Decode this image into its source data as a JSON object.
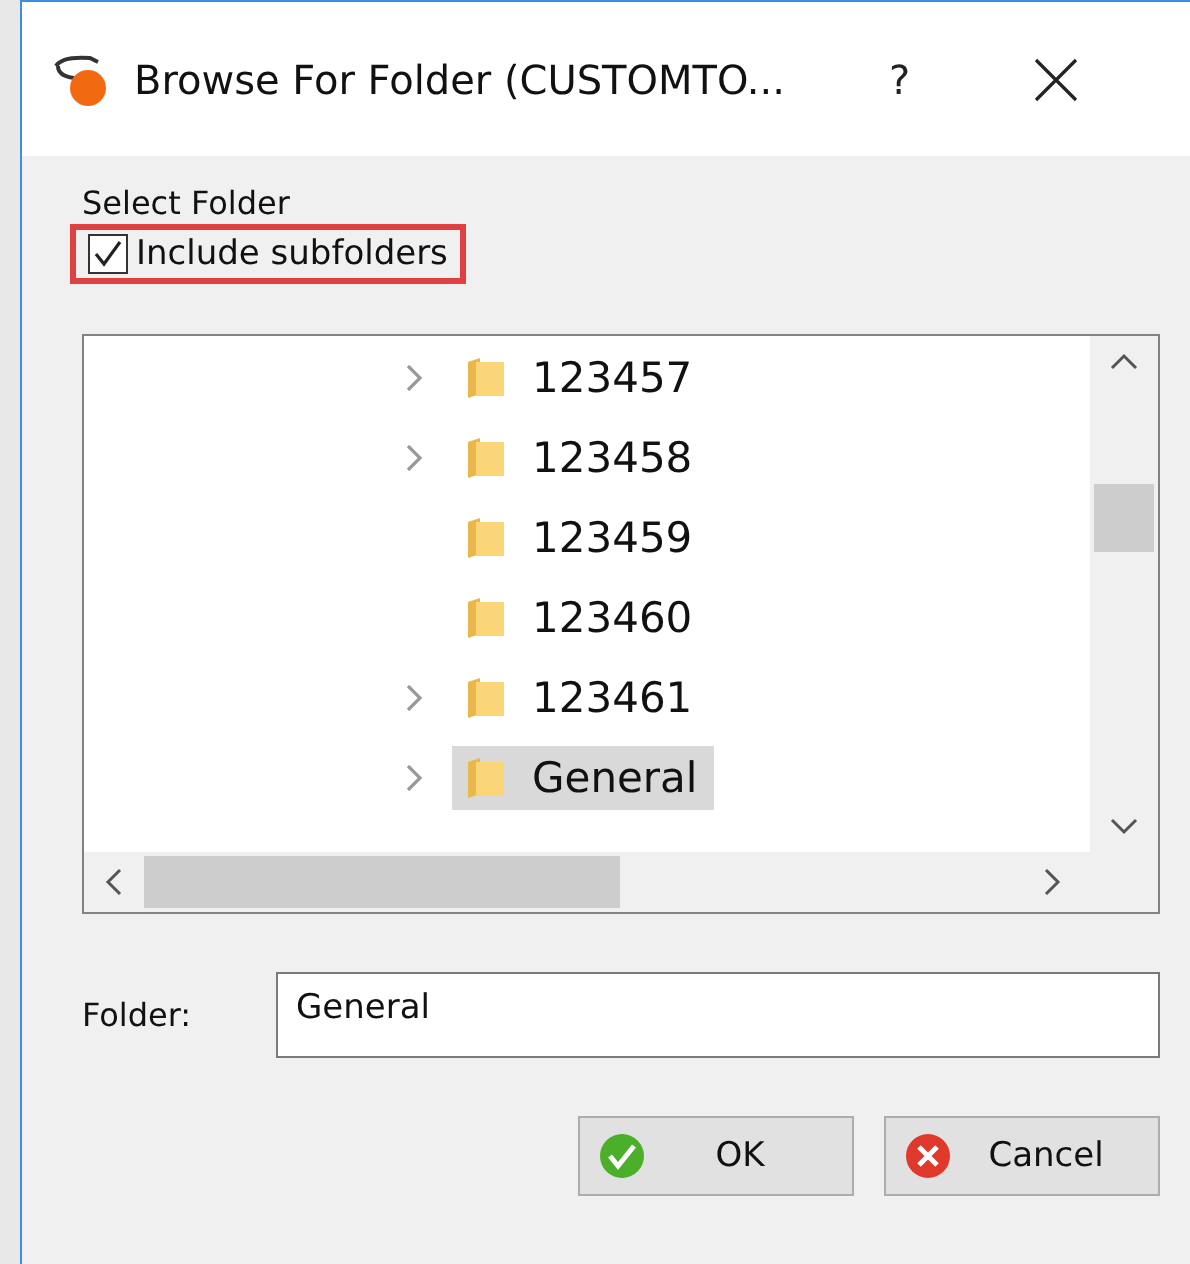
{
  "window": {
    "title": "Browse For Folder (CUSTOMTO...",
    "help": "?"
  },
  "prompt": "Select Folder",
  "include_subfolders": {
    "label": "Include subfolders",
    "checked": true,
    "highlighted": true
  },
  "tree": {
    "items": [
      {
        "label": "123457",
        "expandable": true,
        "selected": false
      },
      {
        "label": "123458",
        "expandable": true,
        "selected": false
      },
      {
        "label": "123459",
        "expandable": false,
        "selected": false
      },
      {
        "label": "123460",
        "expandable": false,
        "selected": false
      },
      {
        "label": "123461",
        "expandable": true,
        "selected": false
      },
      {
        "label": "General",
        "expandable": true,
        "selected": true
      }
    ]
  },
  "folder": {
    "label": "Folder:",
    "value": "General"
  },
  "buttons": [
    {
      "label": "OK",
      "kind": "ok"
    },
    {
      "label": "Cancel",
      "kind": "cancel"
    }
  ]
}
